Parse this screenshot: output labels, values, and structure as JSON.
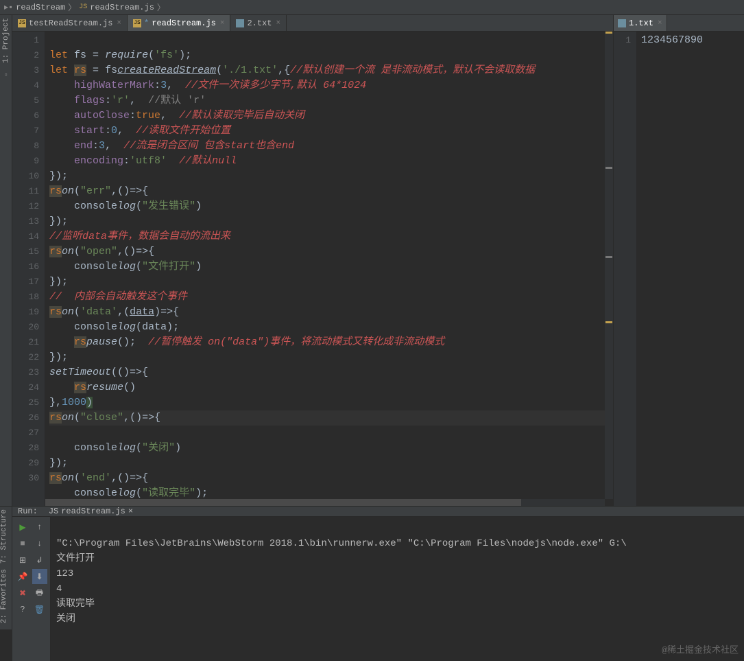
{
  "breadcrumb": {
    "a": "readStream",
    "b": "readStream.js"
  },
  "sidebar": {
    "project": "1: Project",
    "structure": "7: Structure",
    "favorites": "2: Favorites"
  },
  "tabs_left": [
    {
      "label": "testReadStream.js",
      "active": false,
      "mod": false
    },
    {
      "label": "readStream.js",
      "active": true,
      "mod": true
    },
    {
      "label": "2.txt",
      "active": false,
      "mod": false,
      "txt": true
    }
  ],
  "tabs_right": [
    {
      "label": "1.txt",
      "active": true,
      "txt": true
    }
  ],
  "right_content": "1234567890",
  "gutter": [
    "1",
    "2",
    "3",
    "4",
    "5",
    "6",
    "7",
    "8",
    "9",
    "10",
    "11",
    "12",
    "13",
    "14",
    "15",
    "16",
    "17",
    "18",
    "19",
    "20",
    "21",
    "22",
    "23",
    "24",
    "25",
    "26",
    "27",
    "28",
    "29",
    "30"
  ],
  "gutter_r": [
    "1"
  ],
  "run": {
    "label": "Run:",
    "tab": "readStream.js",
    "lines": [
      "\"C:\\Program Files\\JetBrains\\WebStorm 2018.1\\bin\\runnerw.exe\" \"C:\\Program Files\\nodejs\\node.exe\" G:\\",
      "文件打开",
      "123",
      "4",
      "读取完毕",
      "关闭"
    ]
  },
  "watermark": "@稀土掘金技术社区",
  "code": {
    "l1": {
      "let": "let",
      "fs": "fs",
      "eq": " = ",
      "req": "require",
      "op": "(",
      "s": "'fs'",
      "cp": ")",
      ";": ";"
    },
    "l2": {
      "let": "let",
      "rs": "rs",
      "eq": " = ",
      "fs": "fs",
      ".": ".",
      "cr": "createReadStream",
      "op": "(",
      "s": "'./1.txt'",
      "c": ",",
      "bo": "{",
      "cm": "//默认创建一个流 是非流动模式，默认不会读取数据"
    },
    "l3": {
      "k": "highWaterMark",
      ":": ":",
      "n": "3",
      "c": ",",
      "sp": "  ",
      "cm": "//文件一次读多少字节,默认 64*1024"
    },
    "l4": {
      "k": "flags",
      ":": ":",
      "s": "'r'",
      "c": ",",
      "sp": "  ",
      "cm": "//默认 'r'"
    },
    "l5": {
      "k": "autoClose",
      ":": ":",
      "t": "true",
      "c": ",",
      "sp": "  ",
      "cm": "//默认读取完毕后自动关闭"
    },
    "l6": {
      "k": "start",
      ":": ":",
      "n": "0",
      "c": ",",
      "sp": "  ",
      "cm": "//读取文件开始位置"
    },
    "l7": {
      "k": "end",
      ":": ":",
      "n": "3",
      "c": ",",
      "sp": "  ",
      "cm": "//流是闭合区间 包含start也含end"
    },
    "l8": {
      "k": "encoding",
      ":": ":",
      "s": "'utf8'",
      "sp": "  ",
      "cm": "//默认null"
    },
    "l9": {
      "b": "});"
    },
    "l10": {
      "rs": "rs",
      ".": ".",
      "on": "on",
      "op": "(",
      "s": "\"err\"",
      "c": ",",
      "p": "()",
      "ar": "=>{"
    },
    "l11": {
      "pad": "    ",
      "c1": "console",
      ".": ".",
      "lg": "log",
      "op": "(",
      "s": "\"发生错误\"",
      "cp": ")"
    },
    "l12": {
      "b": "});"
    },
    "l13": {
      "cm": "//监听data事件，数据会自动的流出来"
    },
    "l14": {
      "rs": "rs",
      ".": ".",
      "on": "on",
      "op": "(",
      "s": "\"open\"",
      "c": ",",
      "p": "()",
      "ar": "=>{"
    },
    "l15": {
      "pad": "    ",
      "c1": "console",
      ".": ".",
      "lg": "log",
      "op": "(",
      "s": "\"文件打开\"",
      "cp": ")"
    },
    "l16": {
      "b": "});"
    },
    "l17": {
      "cm": "//  内部会自动触发这个事件"
    },
    "l18": {
      "rs": "rs",
      ".": ".",
      "on": "on",
      "op": "(",
      "s": "'data'",
      "c": ",",
      "po": "(",
      "pd": "data",
      "pc": ")",
      "ar": "=>{"
    },
    "l19": {
      "pad": "    ",
      "c1": "console",
      ".": ".",
      "lg": "log",
      "op": "(",
      "d": "data",
      "cp": ")",
      ";": ";"
    },
    "l20": {
      "pad": "    ",
      "rs": "rs",
      ".": ".",
      "ps": "pause",
      "pp": "()",
      ";": ";",
      "sp": "  ",
      "cm": "//暂停触发 on(\"data\")事件，将流动模式又转化成非流动模式"
    },
    "l21": {
      "b": "});"
    },
    "l22": {
      "st": "setTimeout",
      "op": "(",
      "p": "()",
      "ar": "=>{"
    },
    "l23": {
      "pad": "    ",
      "rs": "rs",
      ".": ".",
      "rm": "resume",
      "pp": "()"
    },
    "l24": {
      "b": "},",
      "n": "1000",
      "cp": ")"
    },
    "l25": {
      "rs": "rs",
      ".": ".",
      "on": "on",
      "op": "(",
      "s": "\"close\"",
      "c": ",",
      "p": "()",
      "ar": "=>{"
    },
    "l26": {
      "pad": "    ",
      "c1": "console",
      ".": ".",
      "lg": "log",
      "op": "(",
      "s": "\"关闭\"",
      "cp": ")"
    },
    "l27": {
      "b": "});"
    },
    "l28": {
      "rs": "rs",
      ".": ".",
      "on": "on",
      "op": "(",
      "s": "'end'",
      "c": ",",
      "p": "()",
      "ar": "=>{"
    },
    "l29": {
      "pad": "    ",
      "c1": "console",
      ".": ".",
      "lg": "log",
      "op": "(",
      "s": "\"读取完毕\"",
      "cp": ")",
      ";": ";"
    },
    "l30": {
      "b": "});"
    }
  }
}
